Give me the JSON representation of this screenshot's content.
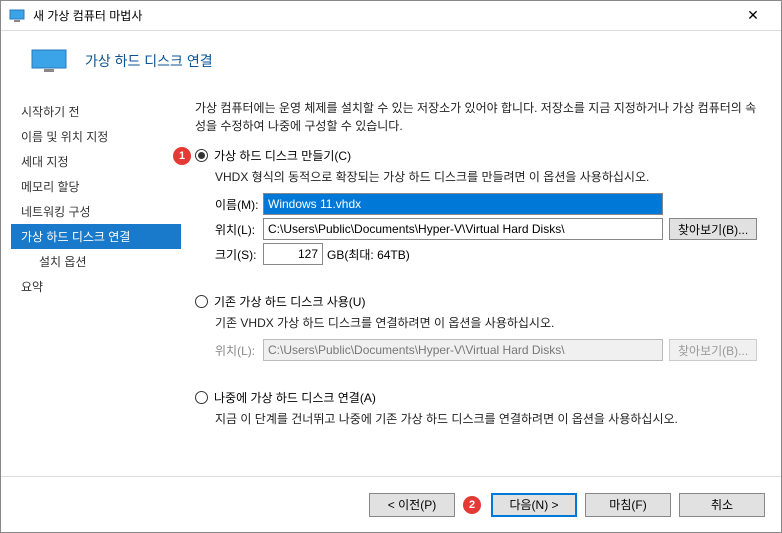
{
  "titlebar": {
    "title": "새 가상 컴퓨터 마법사",
    "close": "✕"
  },
  "header": {
    "title": "가상 하드 디스크 연결"
  },
  "sidebar": {
    "items": [
      "시작하기 전",
      "이름 및 위치 지정",
      "세대 지정",
      "메모리 할당",
      "네트워킹 구성",
      "가상 하드 디스크 연결",
      "설치 옵션",
      "요약"
    ]
  },
  "main": {
    "desc": "가상 컴퓨터에는 운영 체제를 설치할 수 있는 저장소가 있어야 합니다. 저장소를 지금 지정하거나 가상 컴퓨터의 속성을 수정하여 나중에 구성할 수 있습니다.",
    "callout1": "1",
    "opt1": {
      "label": "가상 하드 디스크 만들기(C)",
      "desc": "VHDX 형식의 동적으로 확장되는 가상 하드 디스크를 만들려면 이 옵션을 사용하십시오."
    },
    "name_label": "이름(M):",
    "name_value": "Windows 11.vhdx",
    "loc_label": "위치(L):",
    "loc_value": "C:\\Users\\Public\\Documents\\Hyper-V\\Virtual Hard Disks\\",
    "browse1": "찾아보기(B)...",
    "size_label": "크기(S):",
    "size_value": "127",
    "size_unit": "GB(최대: 64TB)",
    "opt2": {
      "label": "기존 가상 하드 디스크 사용(U)",
      "desc": "기존 VHDX 가상 하드 디스크를 연결하려면 이 옵션을 사용하십시오."
    },
    "loc2_label": "위치(L):",
    "loc2_value": "C:\\Users\\Public\\Documents\\Hyper-V\\Virtual Hard Disks\\",
    "browse2": "찾아보기(B)...",
    "opt3": {
      "label": "나중에 가상 하드 디스크 연결(A)",
      "desc": "지금 이 단계를 건너뛰고 나중에 기존 가상 하드 디스크를 연결하려면 이 옵션을 사용하십시오."
    }
  },
  "footer": {
    "prev": "< 이전(P)",
    "callout2": "2",
    "next": "다음(N) >",
    "finish": "마침(F)",
    "cancel": "취소"
  }
}
